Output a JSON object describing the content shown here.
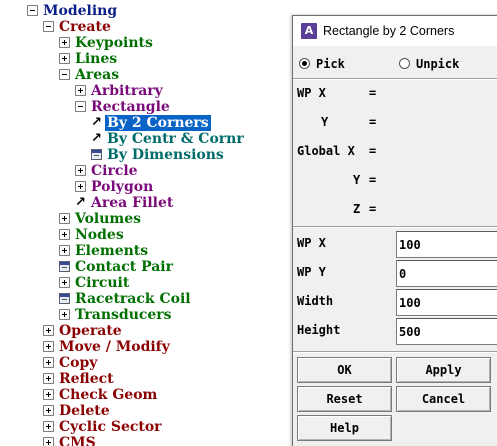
{
  "tree": [
    {
      "id": "modeling",
      "label": "Modeling",
      "icon": "minus",
      "color": "#0b1f8a",
      "indent": 0
    },
    {
      "id": "create",
      "label": "Create",
      "icon": "minus",
      "color": "#8b0000",
      "indent": 1
    },
    {
      "id": "keypoints",
      "label": "Keypoints",
      "icon": "plus",
      "color": "#007000",
      "indent": 2
    },
    {
      "id": "lines",
      "label": "Lines",
      "icon": "plus",
      "color": "#007000",
      "indent": 2
    },
    {
      "id": "areas",
      "label": "Areas",
      "icon": "minus",
      "color": "#007000",
      "indent": 2
    },
    {
      "id": "arbitrary",
      "label": "Arbitrary",
      "icon": "plus",
      "color": "#7a0a7a",
      "indent": 3
    },
    {
      "id": "rectangle",
      "label": "Rectangle",
      "icon": "minus",
      "color": "#7a0a7a",
      "indent": 3
    },
    {
      "id": "by-2-corners",
      "label": "By 2 Corners",
      "icon": "arrow",
      "color": "#ffffff",
      "indent": 4,
      "selected": true
    },
    {
      "id": "by-centr-cornr",
      "label": "By Centr & Cornr",
      "icon": "arrow",
      "color": "#006b6b",
      "indent": 4
    },
    {
      "id": "by-dimensions",
      "label": "By Dimensions",
      "icon": "form",
      "color": "#006b6b",
      "indent": 4
    },
    {
      "id": "circle",
      "label": "Circle",
      "icon": "plus",
      "color": "#7a0a7a",
      "indent": 3
    },
    {
      "id": "polygon",
      "label": "Polygon",
      "icon": "plus",
      "color": "#7a0a7a",
      "indent": 3
    },
    {
      "id": "area-fillet",
      "label": "Area Fillet",
      "icon": "arrow",
      "color": "#7a0a7a",
      "indent": 3
    },
    {
      "id": "volumes",
      "label": "Volumes",
      "icon": "plus",
      "color": "#007000",
      "indent": 2
    },
    {
      "id": "nodes",
      "label": "Nodes",
      "icon": "plus",
      "color": "#007000",
      "indent": 2
    },
    {
      "id": "elements",
      "label": "Elements",
      "icon": "plus",
      "color": "#007000",
      "indent": 2
    },
    {
      "id": "contact-pair",
      "label": "Contact Pair",
      "icon": "form",
      "color": "#007000",
      "indent": 2
    },
    {
      "id": "circuit",
      "label": "Circuit",
      "icon": "plus",
      "color": "#007000",
      "indent": 2
    },
    {
      "id": "racetrack-coil",
      "label": "Racetrack Coil",
      "icon": "form",
      "color": "#007000",
      "indent": 2
    },
    {
      "id": "transducers",
      "label": "Transducers",
      "icon": "plus",
      "color": "#007000",
      "indent": 2
    },
    {
      "id": "operate",
      "label": "Operate",
      "icon": "plus",
      "color": "#8b0000",
      "indent": 1
    },
    {
      "id": "move-modify",
      "label": "Move / Modify",
      "icon": "plus",
      "color": "#8b0000",
      "indent": 1
    },
    {
      "id": "copy",
      "label": "Copy",
      "icon": "plus",
      "color": "#8b0000",
      "indent": 1
    },
    {
      "id": "reflect",
      "label": "Reflect",
      "icon": "plus",
      "color": "#8b0000",
      "indent": 1
    },
    {
      "id": "check-geom",
      "label": "Check Geom",
      "icon": "plus",
      "color": "#8b0000",
      "indent": 1
    },
    {
      "id": "delete",
      "label": "Delete",
      "icon": "plus",
      "color": "#8b0000",
      "indent": 1
    },
    {
      "id": "cyclic-sector",
      "label": "Cyclic Sector",
      "icon": "plus",
      "color": "#8b0000",
      "indent": 1
    },
    {
      "id": "cms",
      "label": "CMS",
      "icon": "plus",
      "color": "#8b0000",
      "indent": 1
    }
  ],
  "dialog": {
    "app_icon_letter": "A",
    "title": "Rectangle by 2 Corners",
    "pick_label": "Pick",
    "unpick_label": "Unpick",
    "pick_selected": true,
    "coords": {
      "wp_x": "WP X",
      "wp_y": "Y",
      "global_x": "Global X",
      "global_y": "Y",
      "global_z": "Z",
      "eq": "="
    },
    "fields": [
      {
        "id": "wp-x",
        "label": "WP X",
        "value": "100"
      },
      {
        "id": "wp-y",
        "label": "WP Y",
        "value": "0"
      },
      {
        "id": "width",
        "label": "Width",
        "value": "100"
      },
      {
        "id": "height",
        "label": "Height",
        "value": "500"
      }
    ],
    "buttons": {
      "ok": "OK",
      "apply": "Apply",
      "reset": "Reset",
      "cancel": "Cancel",
      "help": "Help"
    }
  }
}
